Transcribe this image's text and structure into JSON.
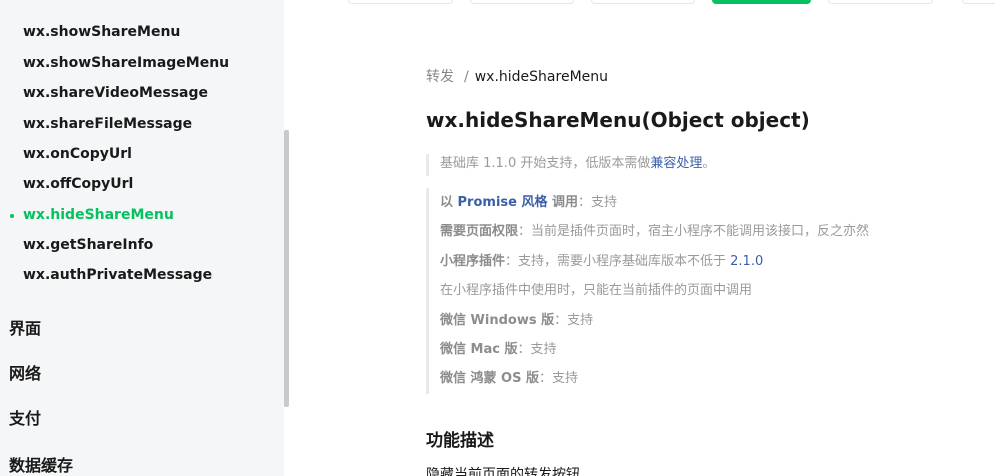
{
  "sidebar": {
    "items": [
      {
        "label": "wx.showShareMenu"
      },
      {
        "label": "wx.showShareImageMenu"
      },
      {
        "label": "wx.shareVideoMessage"
      },
      {
        "label": "wx.shareFileMessage"
      },
      {
        "label": "wx.onCopyUrl"
      },
      {
        "label": "wx.offCopyUrl"
      },
      {
        "label": "wx.hideShareMenu",
        "active": true
      },
      {
        "label": "wx.getShareInfo"
      },
      {
        "label": "wx.authPrivateMessage"
      }
    ],
    "groups": [
      {
        "label": "界面"
      },
      {
        "label": "网络"
      },
      {
        "label": "支付"
      },
      {
        "label": "数据缓存"
      }
    ]
  },
  "main": {
    "breadcrumb": {
      "parent": "转发",
      "separator": "/",
      "current": "wx.hideShareMenu"
    },
    "title": "wx.hideShareMenu(Object object)",
    "support_note": {
      "prefix": "基础库 1.1.0 开始支持，低版本需做",
      "link": "兼容处理",
      "suffix": "。"
    },
    "props": {
      "promise": {
        "prefix": "以 ",
        "link": "Promise 风格",
        "middle": " 调用",
        "value": "：支持"
      },
      "permission": {
        "label": "需要页面权限",
        "value": "：当前是插件页面时，宿主小程序不能调用该接口，反之亦然"
      },
      "plugin": {
        "label": "小程序插件",
        "value": "：支持，需要小程序基础库版本不低于 ",
        "version": "2.1.0"
      },
      "plugin_note": "在小程序插件中使用时，只能在当前插件的页面中调用",
      "windows": {
        "label": "微信 Windows 版",
        "value": "：支持"
      },
      "mac": {
        "label": "微信 Mac 版",
        "value": "：支持"
      },
      "harmony": {
        "label": "微信 鸿蒙 OS 版",
        "value": "：支持"
      }
    },
    "section_title": "功能描述",
    "description": "隐藏当前页面的转发按钮"
  },
  "colors": {
    "accent": "#07c160",
    "link": "#3a5fa8",
    "muted": "#9a9a9a"
  }
}
